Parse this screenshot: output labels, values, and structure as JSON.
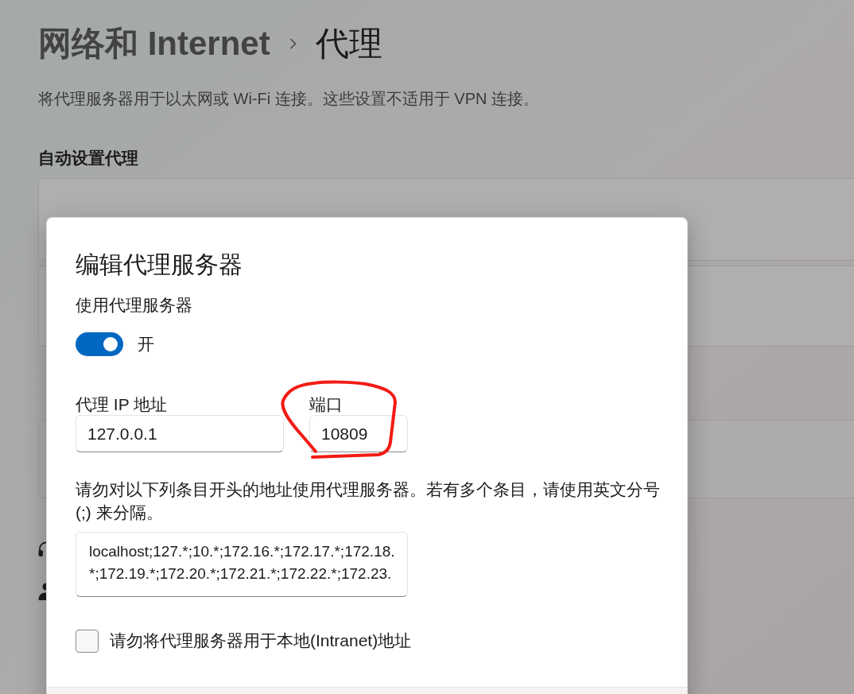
{
  "page": {
    "breadcrumb": [
      {
        "label": "网络和 Internet",
        "current": false
      },
      {
        "label": "代理",
        "current": true
      }
    ],
    "description": "将代理服务器用于以太网或 Wi-Fi 连接。这些设置不适用于 VPN 连接。",
    "section_heading": "自动设置代理"
  },
  "dialog": {
    "title": "编辑代理服务器",
    "proxy_toggle": {
      "label": "使用代理服务器",
      "on": true,
      "state_text": "开"
    },
    "fields": [
      {
        "label": "代理 IP 地址",
        "value": "127.0.0.1"
      },
      {
        "label": "端口",
        "value": "10809"
      }
    ],
    "exceptions": {
      "description": "请勿对以下列条目开头的地址使用代理服务器。若有多个条目，请使用英文分号 (;) 来分隔。",
      "value": "localhost;127.*;10.*;172.16.*;172.17.*;172.18.*;172.19.*;172.20.*;172.21.*;172.22.*;172.23."
    },
    "bypass_local": {
      "label": "请勿将代理服务器用于本地(Intranet)地址",
      "checked": false
    }
  }
}
